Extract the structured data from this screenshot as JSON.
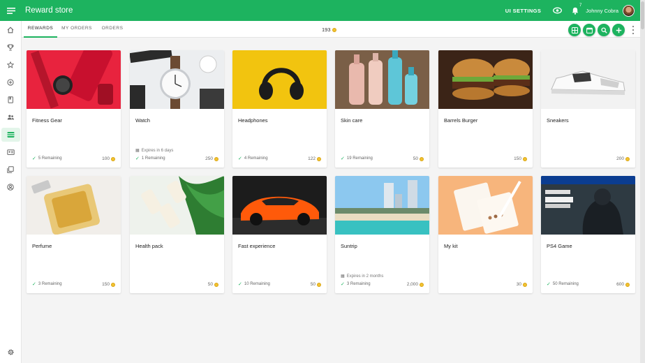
{
  "app": {
    "title": "Reward store"
  },
  "header": {
    "ui_settings_label": "UI SETTINGS",
    "notification_count": "7",
    "user_name": "Johnny Cobra"
  },
  "tabs": [
    {
      "label": "REWARDS",
      "active": true
    },
    {
      "label": "MY ORDERS",
      "active": false
    },
    {
      "label": "ORDERS",
      "active": false
    }
  ],
  "points_balance": "193",
  "toolbar": {
    "actions": [
      "grid-view-icon",
      "calendar-icon",
      "search-icon",
      "add-icon"
    ]
  },
  "sidebar": {
    "items": [
      "home-icon",
      "trophy-icon",
      "star-icon",
      "plus-circle-icon",
      "book-icon",
      "people-icon",
      "store-icon",
      "id-card-icon",
      "gallery-icon",
      "account-circle-icon"
    ],
    "bottom": "settings-gear-icon",
    "active_index": 6
  },
  "rewards": [
    {
      "title": "Fitness Gear",
      "remaining": "5 Remaining",
      "price": "100",
      "expires": ""
    },
    {
      "title": "Watch",
      "remaining": "1 Remaining",
      "price": "250",
      "expires": "Expires in 6 days"
    },
    {
      "title": "Headphones",
      "remaining": "4 Remaining",
      "price": "122",
      "expires": ""
    },
    {
      "title": "Skin care",
      "remaining": "19 Remaining",
      "price": "50",
      "expires": ""
    },
    {
      "title": "Barrels Burger",
      "remaining": "",
      "price": "150",
      "expires": ""
    },
    {
      "title": "Sneakers",
      "remaining": "",
      "price": "200",
      "expires": ""
    },
    {
      "title": "Perfume",
      "remaining": "3 Remaining",
      "price": "150",
      "expires": ""
    },
    {
      "title": "Health pack",
      "remaining": "",
      "price": "50",
      "expires": ""
    },
    {
      "title": "Fast experience",
      "remaining": "10 Remaining",
      "price": "50",
      "expires": ""
    },
    {
      "title": "Suntrip",
      "remaining": "3 Remaining",
      "price": "2,000",
      "expires": "Expires in 2 months"
    },
    {
      "title": "My kit",
      "remaining": "",
      "price": "30",
      "expires": ""
    },
    {
      "title": "PS4 Game",
      "remaining": "50 Remaining",
      "price": "600",
      "expires": ""
    }
  ],
  "colors": {
    "brand": "#1db35f",
    "background": "#f4f4f4",
    "coin": "#f2c230"
  }
}
